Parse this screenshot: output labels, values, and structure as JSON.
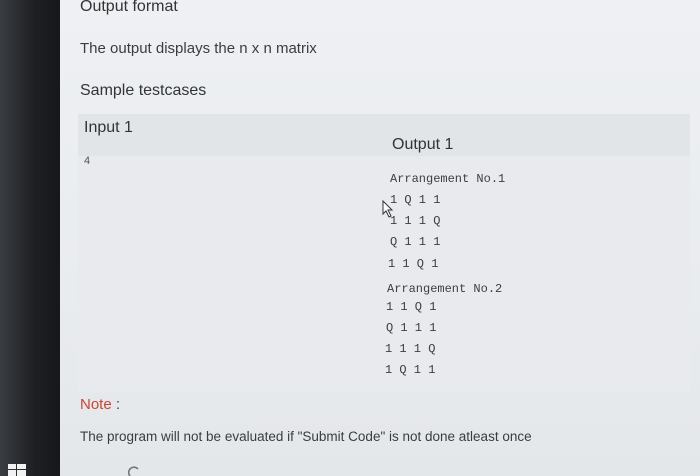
{
  "output_format": {
    "title": "Output format",
    "description": "The output displays the n x n matrix"
  },
  "sample": {
    "title": "Sample testcases",
    "input_label": "Input 1",
    "input_value": "4",
    "output_label": "Output 1",
    "output_lines": [
      "Arrangement No.1",
      "1 Q 1 1",
      "1 1 1 Q",
      "Q 1 1 1",
      "1 1 Q 1",
      "Arrangement No.2",
      "1 1 Q 1",
      "Q 1 1 1",
      "1 1 1 Q",
      "1 Q 1 1"
    ]
  },
  "note": {
    "label": "Note",
    "colon": ":",
    "text": "The program will not be evaluated if \"Submit Code\" is not done atleast once"
  },
  "icons": {
    "cursor": "mouse-pointer-icon",
    "taskbar_start": "windows-start-icon",
    "taskbar_search": "search-icon"
  }
}
